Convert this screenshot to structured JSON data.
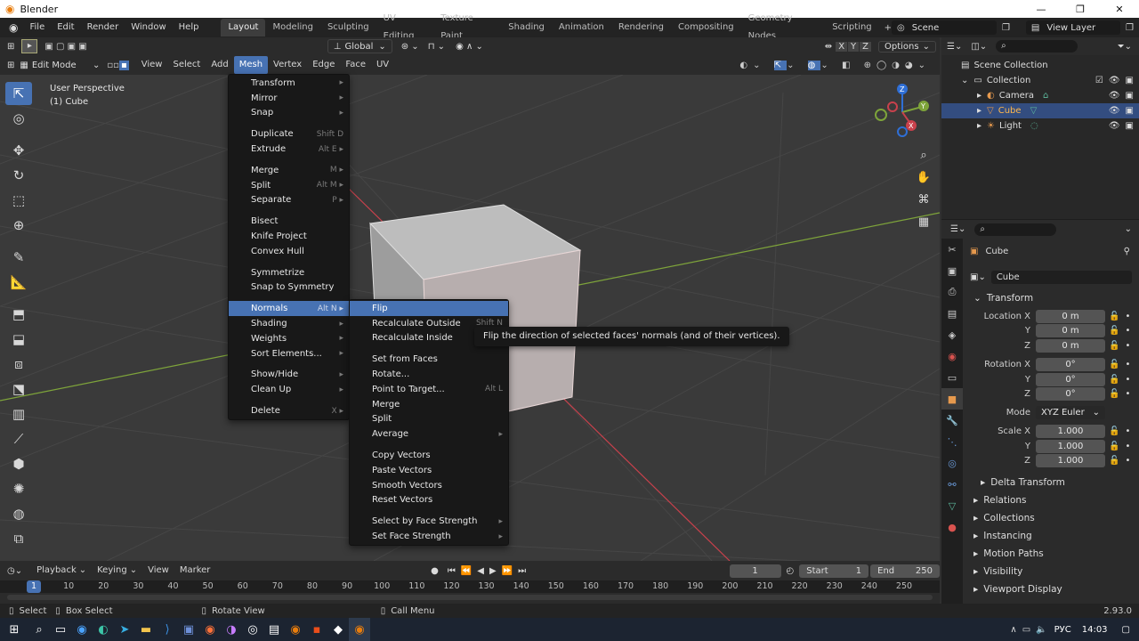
{
  "app": {
    "title": "Blender",
    "version": "2.93.0"
  },
  "topbar": {
    "menus": [
      "File",
      "Edit",
      "Render",
      "Window",
      "Help"
    ],
    "workspaces": [
      "Layout",
      "Modeling",
      "Sculpting",
      "UV Editing",
      "Texture Paint",
      "Shading",
      "Animation",
      "Rendering",
      "Compositing",
      "Geometry Nodes",
      "Scripting"
    ],
    "active_workspace": "Layout",
    "scene": "Scene",
    "view_layer": "View Layer"
  },
  "tool_header": {
    "transform_orientation": "Global",
    "options": "Options",
    "axes": [
      "X",
      "Y",
      "Z"
    ]
  },
  "viewport_header": {
    "mode": "Edit Mode",
    "menus": [
      "View",
      "Select",
      "Add",
      "Mesh",
      "Vertex",
      "Edge",
      "Face",
      "UV"
    ],
    "active_menu": "Mesh"
  },
  "viewport": {
    "perspective": "User Perspective",
    "object": "(1) Cube"
  },
  "mesh_menu": [
    {
      "label": "Transform",
      "shortcut": "▸"
    },
    {
      "label": "Mirror",
      "shortcut": "▸"
    },
    {
      "label": "Snap",
      "shortcut": "▸"
    },
    {
      "sep": true
    },
    {
      "label": "Duplicate",
      "shortcut": "Shift D"
    },
    {
      "label": "Extrude",
      "shortcut": "Alt E ▸"
    },
    {
      "sep": true
    },
    {
      "label": "Merge",
      "shortcut": "M ▸"
    },
    {
      "label": "Split",
      "shortcut": "Alt M ▸"
    },
    {
      "label": "Separate",
      "shortcut": "P ▸"
    },
    {
      "sep": true
    },
    {
      "label": "Bisect",
      "shortcut": ""
    },
    {
      "label": "Knife Project",
      "shortcut": ""
    },
    {
      "label": "Convex Hull",
      "shortcut": ""
    },
    {
      "sep": true
    },
    {
      "label": "Symmetrize",
      "shortcut": ""
    },
    {
      "label": "Snap to Symmetry",
      "shortcut": ""
    },
    {
      "sep": true
    },
    {
      "label": "Normals",
      "shortcut": "Alt N ▸",
      "hl": true
    },
    {
      "label": "Shading",
      "shortcut": "▸"
    },
    {
      "label": "Weights",
      "shortcut": "▸"
    },
    {
      "label": "Sort Elements...",
      "shortcut": "▸"
    },
    {
      "sep": true
    },
    {
      "label": "Show/Hide",
      "shortcut": "▸"
    },
    {
      "label": "Clean Up",
      "shortcut": "▸"
    },
    {
      "sep": true
    },
    {
      "label": "Delete",
      "shortcut": "X ▸"
    }
  ],
  "normals_menu": [
    {
      "label": "Flip",
      "shortcut": "",
      "hl": true
    },
    {
      "label": "Recalculate Outside",
      "shortcut": "Shift N"
    },
    {
      "label": "Recalculate Inside",
      "shortcut": "Shift"
    },
    {
      "sep": true
    },
    {
      "label": "Set from Faces",
      "shortcut": ""
    },
    {
      "label": "Rotate...",
      "shortcut": ""
    },
    {
      "label": "Point to Target...",
      "shortcut": "Alt L"
    },
    {
      "label": "Merge",
      "shortcut": ""
    },
    {
      "label": "Split",
      "shortcut": ""
    },
    {
      "label": "Average",
      "shortcut": "▸"
    },
    {
      "sep": true
    },
    {
      "label": "Copy Vectors",
      "shortcut": ""
    },
    {
      "label": "Paste Vectors",
      "shortcut": ""
    },
    {
      "label": "Smooth Vectors",
      "shortcut": ""
    },
    {
      "label": "Reset Vectors",
      "shortcut": ""
    },
    {
      "sep": true
    },
    {
      "label": "Select by Face Strength",
      "shortcut": "▸"
    },
    {
      "label": "Set Face Strength",
      "shortcut": "▸"
    }
  ],
  "tooltip": "Flip the direction of selected faces' normals (and of their vertices).",
  "outliner": {
    "root": "Scene Collection",
    "collection": "Collection",
    "items": [
      "Camera",
      "Cube",
      "Light"
    ],
    "selected": "Cube"
  },
  "properties": {
    "object_name": "Cube",
    "data_name": "Cube",
    "transform_label": "Transform",
    "location_label": "Location X",
    "rotation_label": "Rotation X",
    "scale_label": "Scale X",
    "y": "Y",
    "z": "Z",
    "location": [
      "0 m",
      "0 m",
      "0 m"
    ],
    "rotation": [
      "0°",
      "0°",
      "0°"
    ],
    "mode_label": "Mode",
    "mode": "XYZ Euler",
    "scale": [
      "1.000",
      "1.000",
      "1.000"
    ],
    "delta": "Delta Transform",
    "panels": [
      "Relations",
      "Collections",
      "Instancing",
      "Motion Paths",
      "Visibility",
      "Viewport Display"
    ]
  },
  "timeline": {
    "menus": [
      "Playback",
      "Keying",
      "View",
      "Marker"
    ],
    "current_frame": "1",
    "start_label": "Start",
    "start": "1",
    "end_label": "End",
    "end": "250",
    "ticks": [
      "1",
      "10",
      "20",
      "30",
      "40",
      "50",
      "60",
      "70",
      "80",
      "90",
      "100",
      "110",
      "120",
      "130",
      "140",
      "150",
      "160",
      "170",
      "180",
      "190",
      "200",
      "210",
      "220",
      "230",
      "240",
      "250"
    ]
  },
  "statusbar": {
    "select": "Select",
    "box_select": "Box Select",
    "rotate_view": "Rotate View",
    "call_menu": "Call Menu"
  },
  "taskbar": {
    "lang": "РУС",
    "time": "14:03"
  },
  "colors": {
    "accent": "#4772b3",
    "cube": "#a9a9a9",
    "x_axis": "#c8414c",
    "y_axis": "#7ea43a"
  }
}
